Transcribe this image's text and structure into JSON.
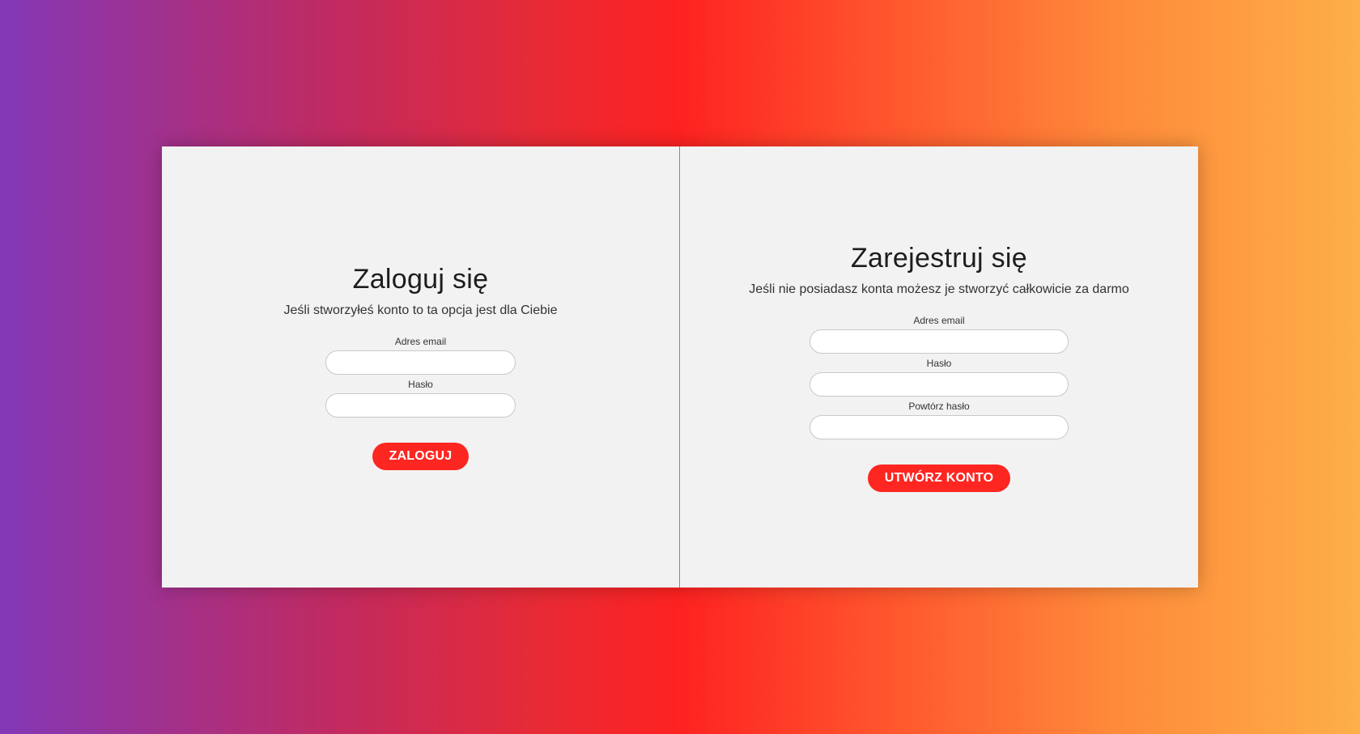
{
  "login": {
    "title": "Zaloguj się",
    "subtitle": "Jeśli stworzyłeś konto to ta opcja jest dla Ciebie",
    "email_label": "Adres email",
    "email_value": "",
    "password_label": "Hasło",
    "password_value": "",
    "submit_label": "ZALOGUJ"
  },
  "register": {
    "title": "Zarejestruj się",
    "subtitle": "Jeśli nie posiadasz konta możesz je stworzyć całkowicie za darmo",
    "email_label": "Adres email",
    "email_value": "",
    "password_label": "Hasło",
    "password_value": "",
    "repeat_password_label": "Powtórz hasło",
    "repeat_password_value": "",
    "submit_label": "UTWÓRZ KONTO"
  },
  "colors": {
    "accent": "#fd2621",
    "card_background": "#f2f2f2",
    "gradient_start": "#8338b7",
    "gradient_mid": "#fe2221",
    "gradient_end": "#fdaf48"
  }
}
